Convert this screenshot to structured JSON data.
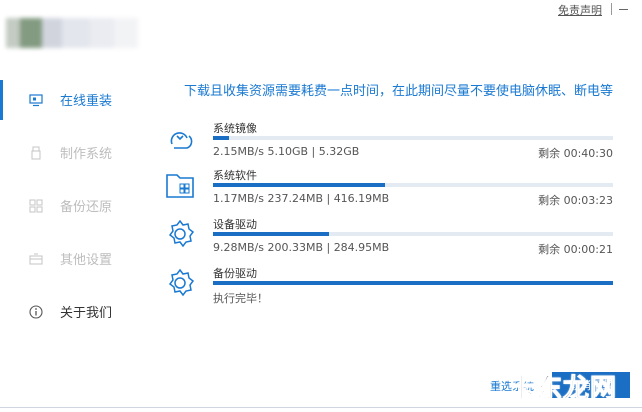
{
  "window": {
    "disclaimer": "免责声明"
  },
  "sidebar": {
    "items": [
      {
        "label": "在线重装",
        "icon": "monitor-icon",
        "state": "active"
      },
      {
        "label": "制作系统",
        "icon": "usb-icon",
        "state": "disabled"
      },
      {
        "label": "备份还原",
        "icon": "grid-icon",
        "state": "disabled"
      },
      {
        "label": "其他设置",
        "icon": "box-icon",
        "state": "disabled"
      },
      {
        "label": "关于我们",
        "icon": "info-icon",
        "state": "normal"
      }
    ]
  },
  "main": {
    "headline": "下载且收集资源需要耗费一点时间，在此期间尽量不要使电脑休眠、断电等",
    "tasks": [
      {
        "name": "系统镜像",
        "icon": "download-cloud-icon",
        "progress": 0.04,
        "stats": "2.15MB/s 5.10GB | 5.32GB",
        "remaining": "剩余 00:40:30"
      },
      {
        "name": "系统软件",
        "icon": "app-folder-icon",
        "progress": 0.43,
        "stats": "1.17MB/s 237.24MB | 416.19MB",
        "remaining": "剩余 00:03:23"
      },
      {
        "name": "设备驱动",
        "icon": "gear-icon",
        "progress": 0.29,
        "stats": "9.28MB/s 200.33MB | 284.95MB",
        "remaining": "剩余 00:00:21"
      },
      {
        "name": "备份驱动",
        "icon": "gear-icon",
        "progress": 1.0,
        "stats": "执行完毕！",
        "remaining": ""
      }
    ]
  },
  "footer": {
    "link_label": "重选系统",
    "button_label": "取消下载",
    "watermark": "卡东龙网"
  },
  "colors": {
    "accent": "#1a79d2",
    "progress_fill": "#1a6ec3",
    "progress_track": "#e4eaf2",
    "disabled_text": "#bdbdbd"
  }
}
